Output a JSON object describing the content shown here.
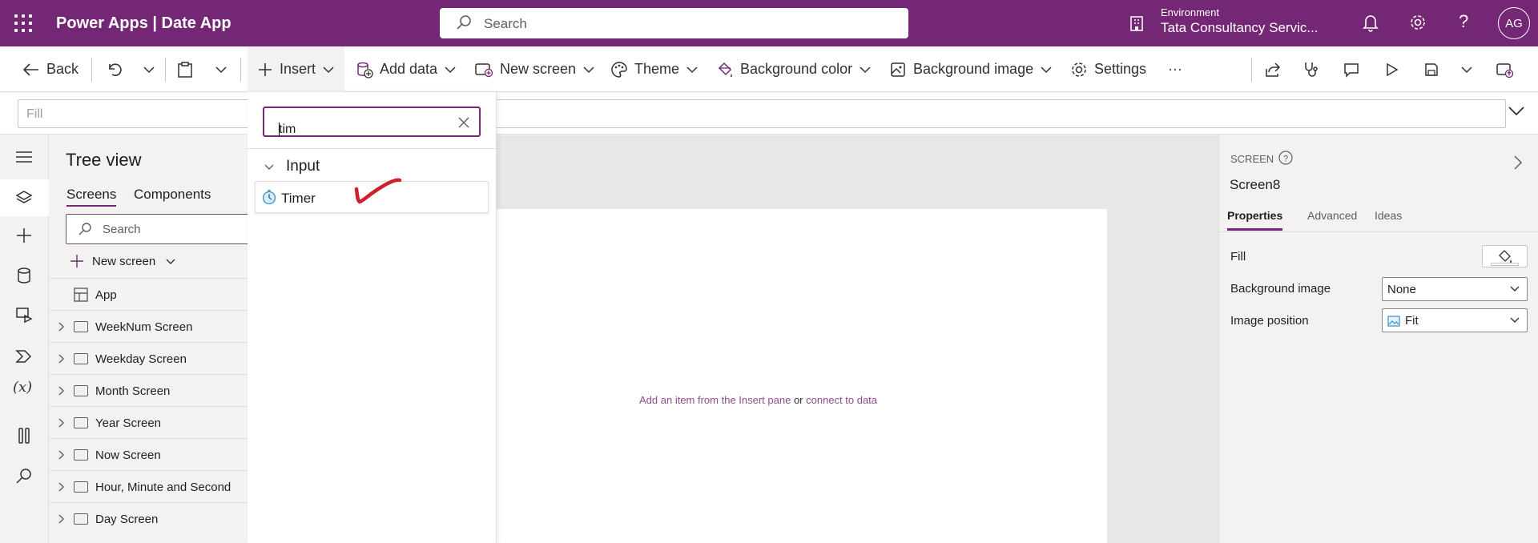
{
  "header": {
    "app_title": "Power Apps  |  Date App",
    "search_placeholder": "Search",
    "environment_label": "Environment",
    "environment_name": "Tata Consultancy Servic...",
    "avatar_initials": "AG"
  },
  "commandbar": {
    "back": "Back",
    "insert": "Insert",
    "add_data": "Add data",
    "new_screen": "New screen",
    "theme": "Theme",
    "background_color": "Background color",
    "background_image": "Background image",
    "settings": "Settings",
    "more": "···"
  },
  "formula": {
    "property": "Fill"
  },
  "tree": {
    "title": "Tree view",
    "tabs": [
      "Screens",
      "Components"
    ],
    "search_placeholder": "Search",
    "new_screen": "New screen",
    "items": [
      "App",
      "WeekNum Screen",
      "Weekday Screen",
      "Month Screen",
      "Year Screen",
      "Now Screen",
      "Hour, Minute and Second",
      "Day Screen"
    ]
  },
  "insert_panel": {
    "search_value": "tim",
    "group": "Input",
    "item": "Timer"
  },
  "canvas": {
    "hint_prefix": "Add an item from the Insert pane",
    "hint_or": " or ",
    "hint_link": "connect to data"
  },
  "properties": {
    "type": "SCREEN",
    "name": "Screen8",
    "tabs": [
      "Properties",
      "Advanced",
      "Ideas"
    ],
    "fill_label": "Fill",
    "bg_image_label": "Background image",
    "bg_image_value": "None",
    "image_position_label": "Image position",
    "image_position_value": "Fit"
  },
  "colors": {
    "brand": "#742774",
    "annotation": "#d0202b"
  }
}
